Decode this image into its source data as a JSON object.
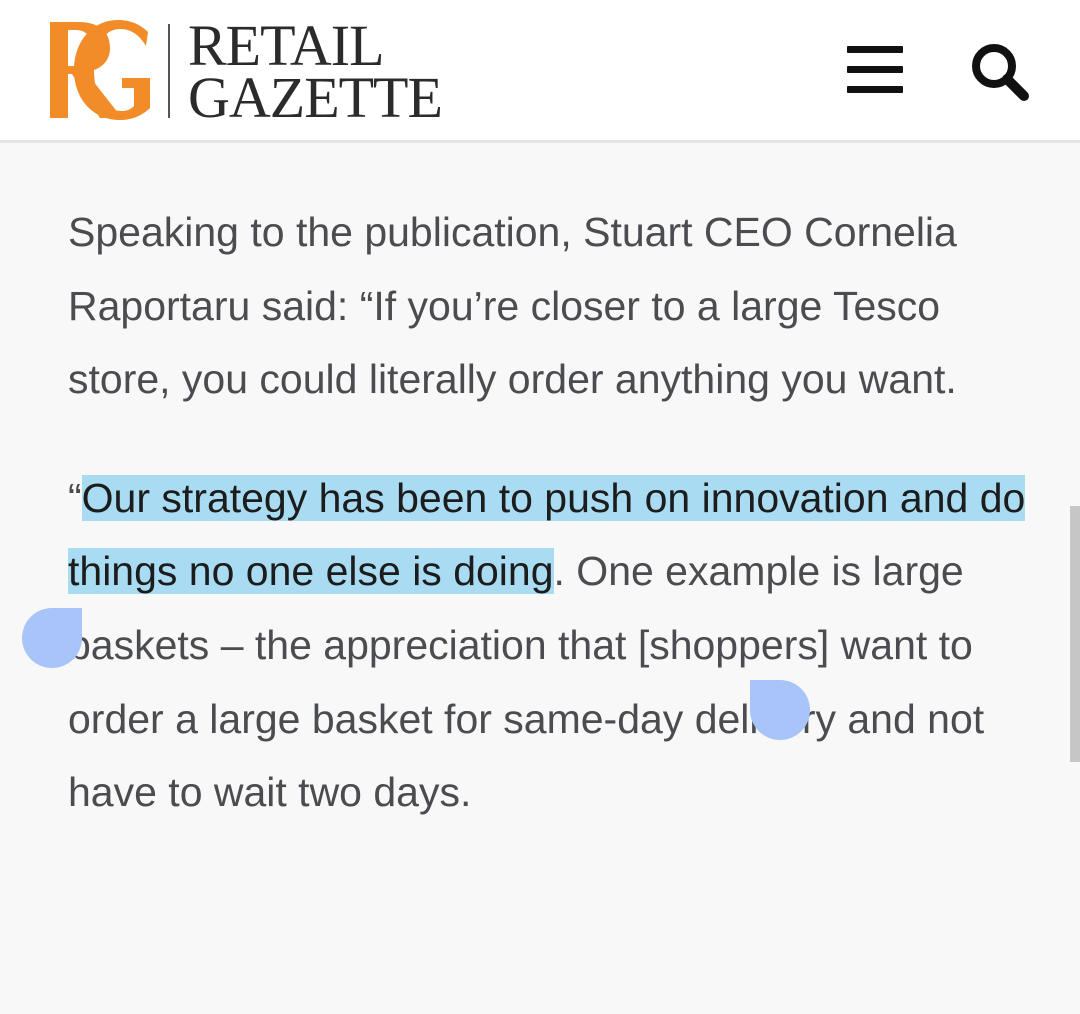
{
  "header": {
    "logo": {
      "monogram": "RG",
      "line1": "RETAIL",
      "line2": "GAZETTE",
      "brand_color": "#F28C28"
    },
    "menu_icon": "hamburger-menu-icon",
    "search_icon": "search-icon"
  },
  "article": {
    "para1": "Speaking to the publication, Stuart CEO Cornelia Raportaru said: “If you’re closer to a large Tesco store, you could literally order anything you want.",
    "para2": {
      "open_quote": "“",
      "selected_text": "Our strategy has been to push on innovation and do things no one else is doing",
      "rest": ". One example is large baskets – the appreciation that [shoppers] want to order a large basket for same-day delivery and not have to wait two days."
    }
  },
  "colors": {
    "background": "#F8F8F8",
    "text": "#4B4C50",
    "selection": "#A9DCF2",
    "selection_handle": "#A9C4F8"
  }
}
